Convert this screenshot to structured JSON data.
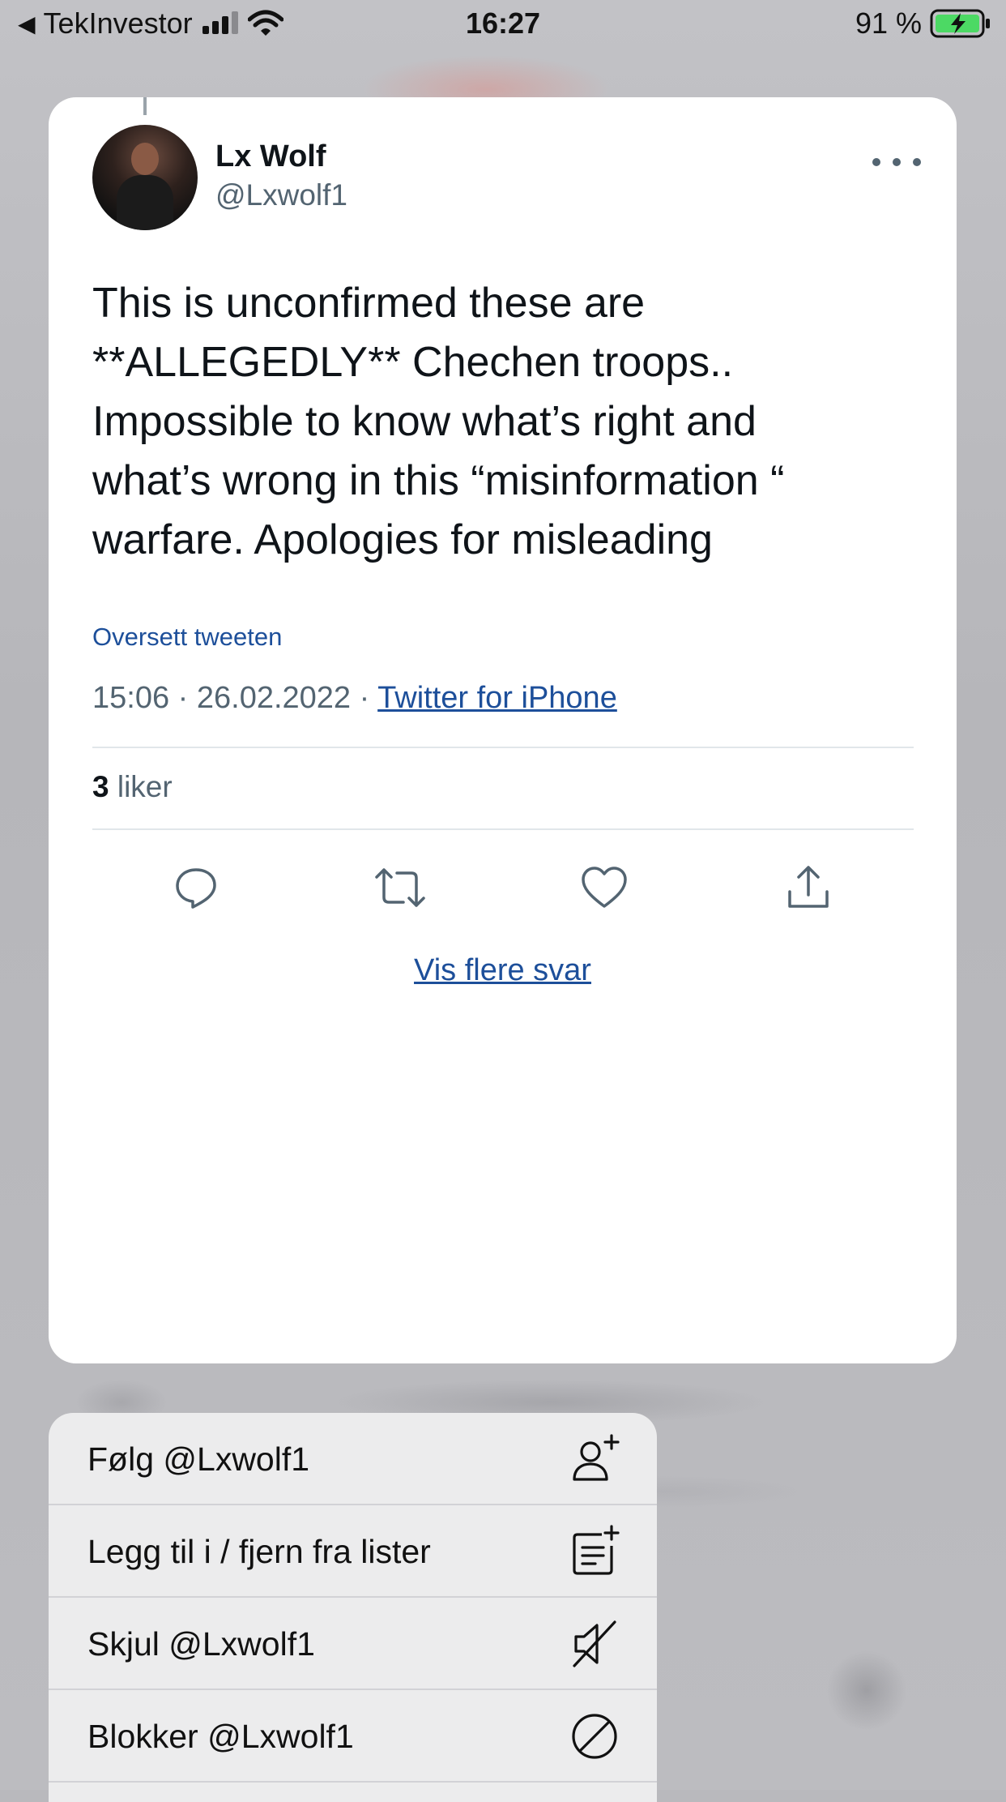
{
  "status_bar": {
    "back_app": "TekInvestor",
    "time": "16:27",
    "battery": "91 %"
  },
  "tweet": {
    "name": "Lx Wolf",
    "handle": "@Lxwolf1",
    "text": "This is unconfirmed these are **ALLEGEDLY** Chechen troops.. Impossible to know what’s right and what’s wrong in this “misinformation “ warfare. Apologies for misleading",
    "translate": "Oversett tweeten",
    "timestamp": "15:06 · 26.02.2022 · ",
    "source": "Twitter for iPhone",
    "likes_count": "3",
    "likes_label": "liker",
    "more_replies": "Vis flere svar"
  },
  "menu": {
    "items": [
      {
        "label": "Følg @Lxwolf1",
        "icon": "add-user-icon"
      },
      {
        "label": "Legg til i / fjern fra lister",
        "icon": "add-to-list-icon"
      },
      {
        "label": "Skjul @Lxwolf1",
        "icon": "mute-icon"
      },
      {
        "label": "Blokker @Lxwolf1",
        "icon": "block-icon"
      }
    ]
  },
  "colors": {
    "link": "#1d4f9a",
    "text": "#0f1419",
    "secondary": "#536471"
  }
}
